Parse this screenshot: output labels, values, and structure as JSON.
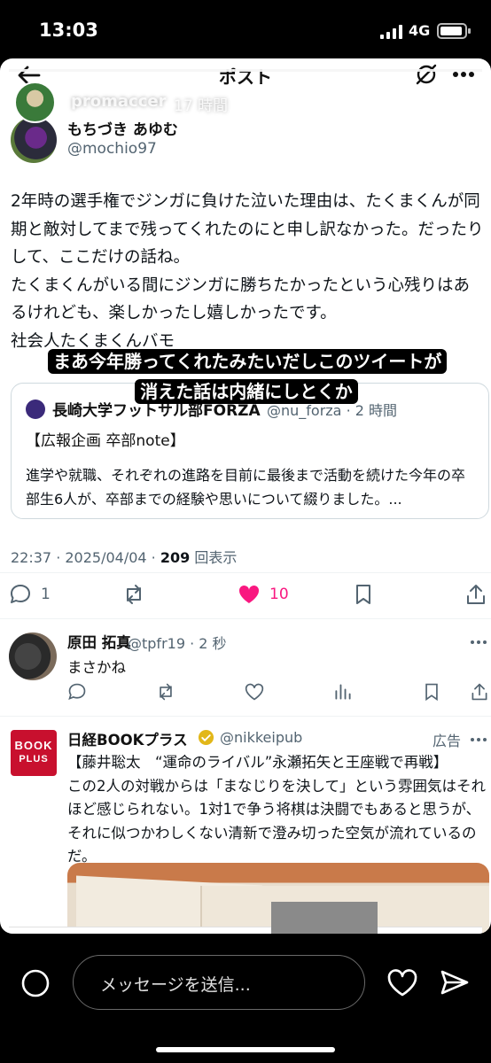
{
  "status": {
    "time": "13:03",
    "network": "4G"
  },
  "story": {
    "username": "promaccer",
    "time_ago": "17 時間",
    "progress_fraction": 1.0,
    "caption": "まあ今年勝ってくれたみたいだしこのツイートが消えた話は内緒にしとくか"
  },
  "x_header": {
    "title": "ポスト"
  },
  "post": {
    "author_name": "もちづき あゆむ",
    "author_handle": "@mochio97",
    "text": "2年時の選手権でジンガに負けた泣いた理由は、たくまくんが同期と敵対してまで残ってくれたのにと申し訳なかった。だったりして、ここだけの話ね。\nたくまくんがいる間にジンガに勝ちたかったという心残りはあるけれども、楽しかったし嬉しかったです。\n社会人たくまくんバモ",
    "quote": {
      "name": "長崎大学フットサル部FORZA",
      "meta": "@nu_forza · 2 時間",
      "headline": "【広報企画 卒部note】",
      "body": "進学や就職、それぞれの進路を目前に最後まで活動を続けた今年の卒部生6人が、卒部までの経験や思いについて綴りました。..."
    },
    "timestamp": "22:37 · 2025/04/04 · ",
    "views_count": "209",
    "views_label": " 回表示",
    "replies": "1",
    "likes": "10"
  },
  "reply": {
    "name": "原田 拓真",
    "meta": "@tpfr19 · 2 秒",
    "text": "まさかね"
  },
  "ad": {
    "logo_line1": "BOOK",
    "logo_line2": "PLUS",
    "name": "日経BOOKプラス",
    "handle": "@nikkeipub",
    "tag": "広告",
    "text": "【藤井聡太　“運命のライバル”永瀬拓矢と王座戦で再戦】\nこの2人の対戦からは「まなじりを決して」という雰囲気はそれほど感じられない。1対1で争う将棋は決闘でもあると思うが、それに似つかわしくない清新で澄み切った空気が流れているのだ。"
  },
  "bottom": {
    "message_placeholder": "メッセージを送信..."
  },
  "colors": {
    "like_pink": "#f91880",
    "secondary_text": "#536471",
    "ad_logo_red": "#c8102e"
  }
}
